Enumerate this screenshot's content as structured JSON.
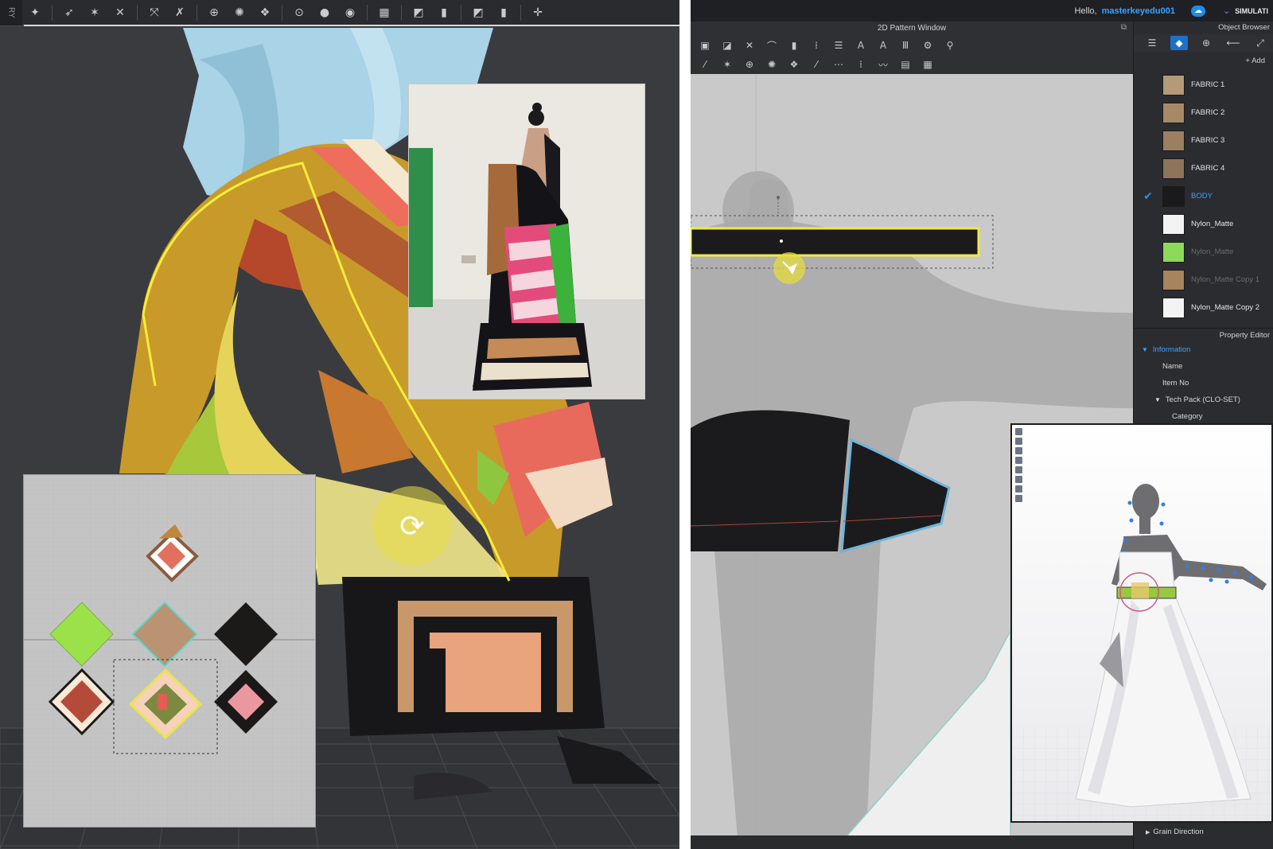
{
  "left_panel": {
    "edge_label": "RY",
    "toolbar_icons": [
      "arrange-avatar",
      "select-move",
      "transform",
      "fold",
      "arrange",
      "pin",
      "tack",
      "sew",
      "fold-arrange",
      "strengthen",
      "sew-point",
      "hanger",
      "measure",
      "texture",
      "graphic",
      "texture-2",
      "graphic-2",
      "gizmo"
    ],
    "rotate_cursor_glyph": "⟳"
  },
  "right_panel": {
    "topbar": {
      "greeting": "Hello,",
      "username": "masterkeyedu001",
      "simulation_label": "SIMULATI"
    },
    "pattern_window": {
      "title": "2D Pattern Window"
    },
    "object_browser": {
      "title": "Object Browser",
      "add_label": "+ Add",
      "items": [
        {
          "label": "FABRIC 1",
          "swatch": "#b59a7a",
          "state": "normal"
        },
        {
          "label": "FABRIC 2",
          "swatch": "#a88966",
          "state": "normal"
        },
        {
          "label": "FABRIC 3",
          "swatch": "#9a7f61",
          "state": "normal"
        },
        {
          "label": "FABRIC 4",
          "swatch": "#8e7459",
          "state": "normal"
        },
        {
          "label": "BODY",
          "swatch": "#1a1a1c",
          "state": "selected"
        },
        {
          "label": "Nylon_Matte",
          "swatch": "#f3f3f3",
          "state": "normal"
        },
        {
          "label": "Nylon_Matte",
          "swatch": "#8fd95a",
          "state": "faded"
        },
        {
          "label": "Nylon_Matte Copy 1",
          "swatch": "#a7835e",
          "state": "faded"
        },
        {
          "label": "Nylon_Matte Copy 2",
          "swatch": "#f3f3f3",
          "state": "normal"
        }
      ]
    },
    "property_editor": {
      "title": "Property Editor",
      "section": "Information",
      "rows": [
        "Name",
        "Item No"
      ],
      "tech_pack": "Tech Pack (CLO-SET)",
      "category": "Category"
    },
    "grain_direction": "Grain Direction"
  }
}
